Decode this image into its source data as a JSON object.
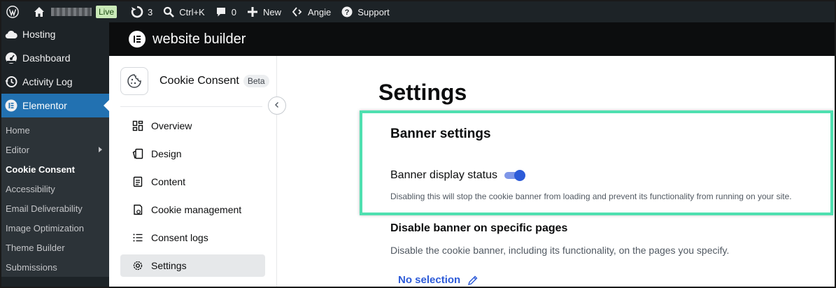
{
  "adminbar": {
    "wp_logo_icon": "wordpress-logo-icon",
    "home_icon": "home-icon",
    "live_label": "Live",
    "updates_icon": "updates-icon",
    "updates_count": "3",
    "search_icon": "search-icon",
    "search_shortcut": "Ctrl+K",
    "comments_icon": "comment-icon",
    "comments_count": "0",
    "new_icon": "plus-icon",
    "new_label": "New",
    "angie_icon": "sparkle-icon",
    "angie_label": "Angie",
    "support_icon": "help-icon",
    "support_label": "Support"
  },
  "sidebar": {
    "items": [
      {
        "label": "Hosting",
        "icon": "cloud-icon"
      },
      {
        "label": "Dashboard",
        "icon": "dashboard-icon"
      },
      {
        "label": "Activity Log",
        "icon": "history-icon"
      },
      {
        "label": "Elementor",
        "icon": "elementor-icon"
      }
    ],
    "submenu": [
      {
        "label": "Home"
      },
      {
        "label": "Editor"
      },
      {
        "label": "Cookie Consent"
      },
      {
        "label": "Accessibility"
      },
      {
        "label": "Email Deliverability"
      },
      {
        "label": "Image Optimization"
      },
      {
        "label": "Theme Builder"
      },
      {
        "label": "Submissions"
      }
    ]
  },
  "header": {
    "title": "website builder",
    "logo_icon": "elementor-logo-icon"
  },
  "plugin": {
    "name": "Cookie Consent",
    "badge": "Beta",
    "icon": "cookie-icon",
    "collapse_icon": "chevron-left-icon",
    "nav": [
      {
        "label": "Overview",
        "icon": "grid-icon"
      },
      {
        "label": "Design",
        "icon": "design-icon"
      },
      {
        "label": "Content",
        "icon": "document-icon"
      },
      {
        "label": "Cookie management",
        "icon": "cookie-file-icon"
      },
      {
        "label": "Consent logs",
        "icon": "list-icon"
      },
      {
        "label": "Settings",
        "icon": "gear-icon"
      }
    ]
  },
  "main": {
    "title": "Settings",
    "banner_settings": {
      "heading": "Banner settings",
      "toggle_label": "Banner display status",
      "toggle_on": true,
      "help": "Disabling this will stop the cookie banner from loading and prevent its functionality from running on your site."
    },
    "disable_pages": {
      "heading": "Disable banner on specific pages",
      "description": "Disable the cookie banner, including its functionality, on the pages you specify.",
      "selection_label": "No selection",
      "edit_icon": "pencil-icon"
    }
  },
  "colors": {
    "highlight_border": "#4fe0b0",
    "active_menu": "#2271b1",
    "link": "#2d5bd8"
  }
}
